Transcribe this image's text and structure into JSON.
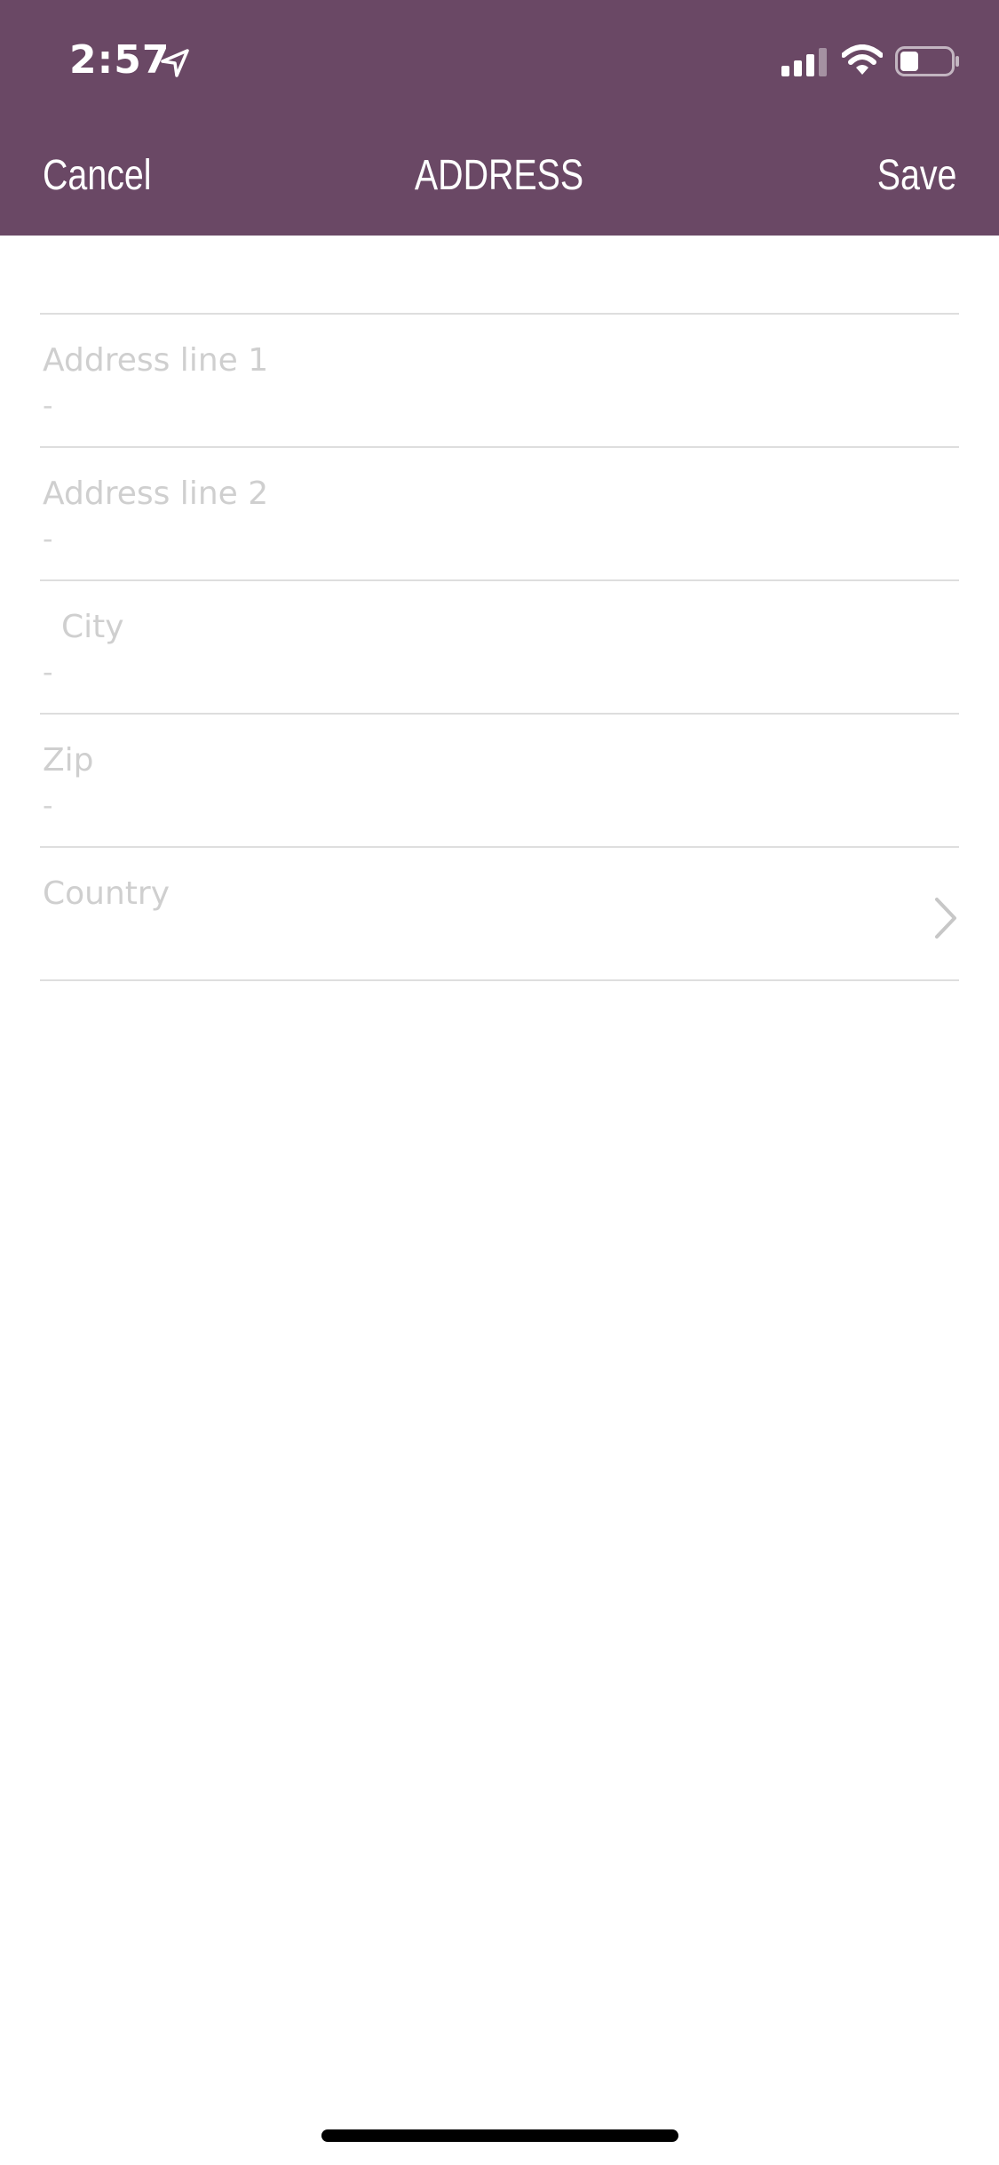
{
  "status_bar": {
    "time": "2:57",
    "icons": [
      "location-arrow-icon",
      "cellular-signal-icon",
      "wifi-icon",
      "battery-icon"
    ]
  },
  "nav": {
    "cancel_label": "Cancel",
    "title": "ADDRESS",
    "save_label": "Save"
  },
  "form": {
    "fields": [
      {
        "label": "Address line 1",
        "value": "-"
      },
      {
        "label": "Address line 2",
        "value": "-"
      },
      {
        "label": "City",
        "value": "-"
      },
      {
        "label": "Zip",
        "value": "-"
      },
      {
        "label": "Country",
        "value": ""
      }
    ]
  },
  "colors": {
    "header_background": "#6a4865",
    "header_text": "#ffffff",
    "divider": "#dedede",
    "placeholder_text": "#cfcfcf",
    "background": "#ffffff"
  }
}
